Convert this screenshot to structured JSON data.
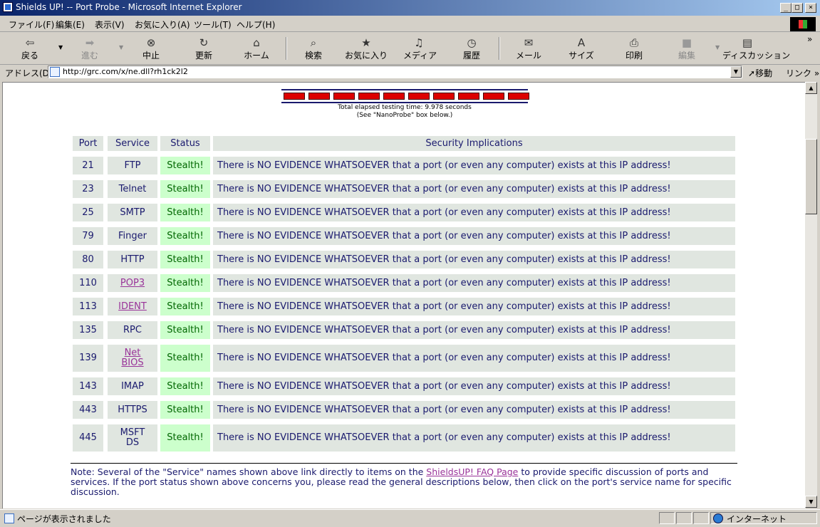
{
  "window": {
    "title": "Shields UP! -- Port Probe - Microsoft Internet Explorer",
    "minimize": "_",
    "maximize": "□",
    "close": "×"
  },
  "menu": [
    "ファイル(F)",
    "編集(E)",
    "表示(V)",
    "お気に入り(A)",
    "ツール(T)",
    "ヘルプ(H)"
  ],
  "toolbar": {
    "back": "戻る",
    "forward": "進む",
    "stop": "中止",
    "refresh": "更新",
    "home": "ホーム",
    "search": "検索",
    "favorites": "お気に入り",
    "media": "メディア",
    "history": "履歴",
    "mail": "メール",
    "size": "サイズ",
    "print": "印刷",
    "edit": "編集",
    "discuss": "ディスカッション",
    "more": "»"
  },
  "address": {
    "label": "アドレス(D)",
    "url": "http://grc.com/x/ne.dll?rh1ck2l2",
    "go": "移動",
    "links": "リンク »"
  },
  "probe": {
    "segments": 10,
    "elapsed_line1": "Total elapsed testing time: 9.978 seconds",
    "elapsed_line2": "(See \"NanoProbe\" box below.)"
  },
  "table": {
    "headers": {
      "port": "Port",
      "service": "Service",
      "status": "Status",
      "implications": "Security Implications"
    },
    "rows": [
      {
        "port": "21",
        "service": "FTP",
        "service2": "",
        "link": false,
        "status": "Stealth!",
        "implication": "There is NO EVIDENCE WHATSOEVER that a port (or even any computer) exists at this IP address!"
      },
      {
        "port": "23",
        "service": "Telnet",
        "service2": "",
        "link": false,
        "status": "Stealth!",
        "implication": "There is NO EVIDENCE WHATSOEVER that a port (or even any computer) exists at this IP address!"
      },
      {
        "port": "25",
        "service": "SMTP",
        "service2": "",
        "link": false,
        "status": "Stealth!",
        "implication": "There is NO EVIDENCE WHATSOEVER that a port (or even any computer) exists at this IP address!"
      },
      {
        "port": "79",
        "service": "Finger",
        "service2": "",
        "link": false,
        "status": "Stealth!",
        "implication": "There is NO EVIDENCE WHATSOEVER that a port (or even any computer) exists at this IP address!"
      },
      {
        "port": "80",
        "service": "HTTP",
        "service2": "",
        "link": false,
        "status": "Stealth!",
        "implication": "There is NO EVIDENCE WHATSOEVER that a port (or even any computer) exists at this IP address!"
      },
      {
        "port": "110",
        "service": "POP3",
        "service2": "",
        "link": true,
        "status": "Stealth!",
        "implication": "There is NO EVIDENCE WHATSOEVER that a port (or even any computer) exists at this IP address!"
      },
      {
        "port": "113",
        "service": "IDENT",
        "service2": "",
        "link": true,
        "status": "Stealth!",
        "implication": "There is NO EVIDENCE WHATSOEVER that a port (or even any computer) exists at this IP address!"
      },
      {
        "port": "135",
        "service": "RPC",
        "service2": "",
        "link": false,
        "status": "Stealth!",
        "implication": "There is NO EVIDENCE WHATSOEVER that a port (or even any computer) exists at this IP address!"
      },
      {
        "port": "139",
        "service": "Net",
        "service2": "BIOS",
        "link": true,
        "status": "Stealth!",
        "implication": "There is NO EVIDENCE WHATSOEVER that a port (or even any computer) exists at this IP address!"
      },
      {
        "port": "143",
        "service": "IMAP",
        "service2": "",
        "link": false,
        "status": "Stealth!",
        "implication": "There is NO EVIDENCE WHATSOEVER that a port (or even any computer) exists at this IP address!"
      },
      {
        "port": "443",
        "service": "HTTPS",
        "service2": "",
        "link": false,
        "status": "Stealth!",
        "implication": "There is NO EVIDENCE WHATSOEVER that a port (or even any computer) exists at this IP address!"
      },
      {
        "port": "445",
        "service": "MSFT",
        "service2": "DS",
        "link": false,
        "status": "Stealth!",
        "implication": "There is NO EVIDENCE WHATSOEVER that a port (or even any computer) exists at this IP address!"
      }
    ]
  },
  "note": {
    "before": "Note: Several of the \"Service\" names shown above link directly to items on the ",
    "link": "ShieldsUP! FAQ Page",
    "after": " to provide specific discussion of ports and services. If the port status shown above concerns you, please read the general descriptions below, then click on the port's service name for specific discussion."
  },
  "status": {
    "message": "ページが表示されました",
    "zone": "インターネット"
  },
  "colors": {
    "title_bar": "#0a246a",
    "cell_bg": "#e0e6e0",
    "stealth_bg": "#ccffcc",
    "text": "#1a1a6e",
    "link": "#993399",
    "progress": "#dd0000"
  }
}
